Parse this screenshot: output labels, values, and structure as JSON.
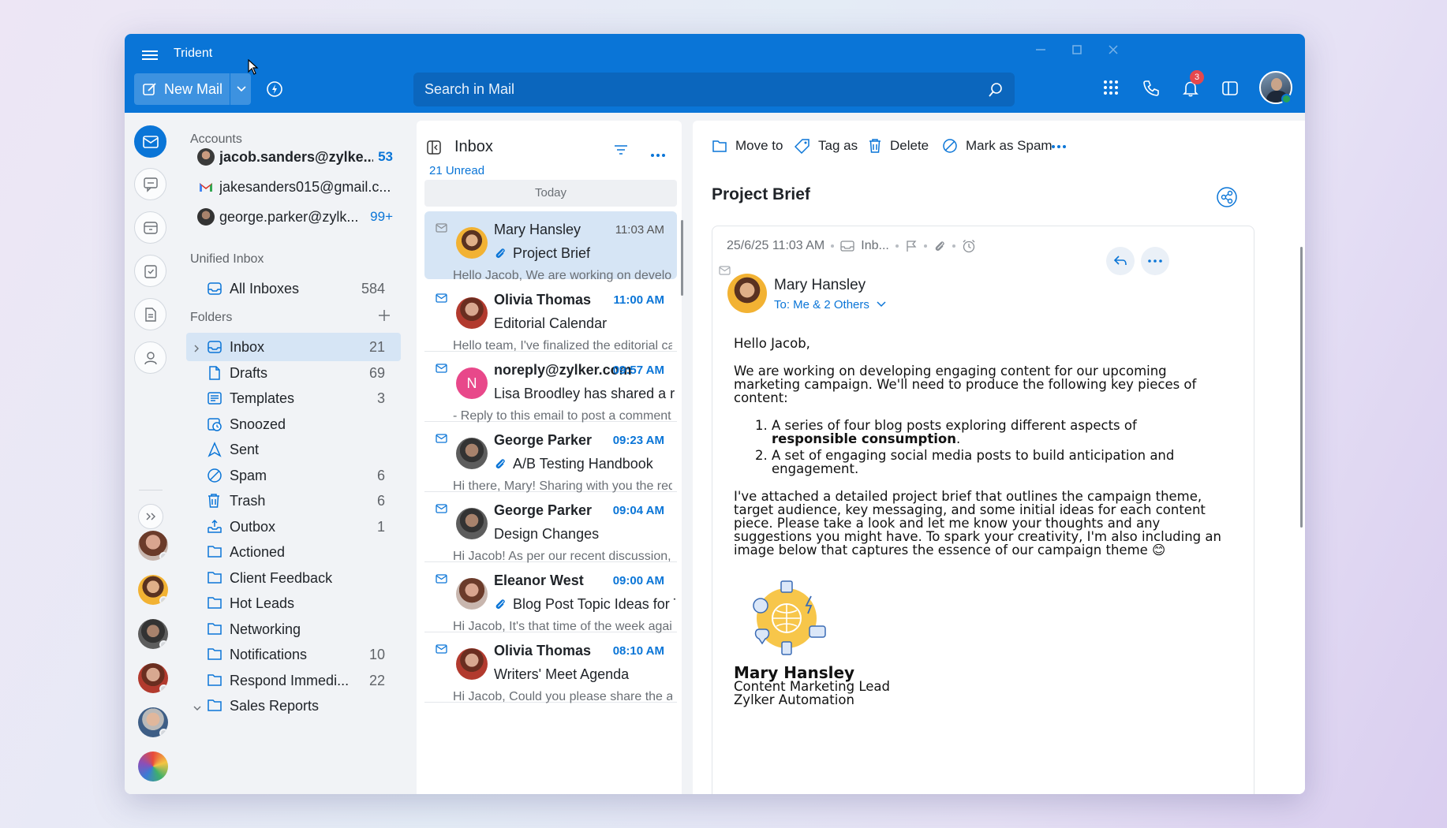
{
  "app": {
    "title": "Trident"
  },
  "toolbar": {
    "new_mail_label": "New Mail",
    "search_placeholder": "Search in Mail",
    "notification_count": "3"
  },
  "accounts": {
    "header": "Accounts",
    "items": [
      {
        "email": "jacob.sanders@zylke...",
        "count": "53"
      },
      {
        "email": "jakesanders015@gmail.c...",
        "count": ""
      },
      {
        "email": "george.parker@zylk...",
        "count": "99+"
      }
    ]
  },
  "unified": {
    "header": "Unified Inbox",
    "all_inboxes": {
      "label": "All Inboxes",
      "count": "584"
    }
  },
  "folders": {
    "header": "Folders",
    "items": [
      {
        "label": "Inbox",
        "count": "21"
      },
      {
        "label": "Drafts",
        "count": "69"
      },
      {
        "label": "Templates",
        "count": "3"
      },
      {
        "label": "Snoozed",
        "count": ""
      },
      {
        "label": "Sent",
        "count": ""
      },
      {
        "label": "Spam",
        "count": "6"
      },
      {
        "label": "Trash",
        "count": "6"
      },
      {
        "label": "Outbox",
        "count": "1"
      },
      {
        "label": "Actioned",
        "count": ""
      },
      {
        "label": "Client Feedback",
        "count": ""
      },
      {
        "label": "Hot Leads",
        "count": ""
      },
      {
        "label": "Networking",
        "count": ""
      },
      {
        "label": "Notifications",
        "count": "10"
      },
      {
        "label": "Respond Immedi...",
        "count": "22"
      },
      {
        "label": "Sales Reports",
        "count": ""
      }
    ]
  },
  "list": {
    "title": "Inbox",
    "unread": "21 Unread",
    "group": "Today",
    "mails": [
      {
        "from": "Mary Hansley",
        "time": "11:03 AM",
        "subject": "Project Brief",
        "preview": "Hello Jacob, We are working on developin...",
        "initial": ""
      },
      {
        "from": "Olivia Thomas",
        "time": "11:00 AM",
        "subject": "Editorial Calendar",
        "preview": "Hello team, I've finalized the editorial cale...",
        "initial": ""
      },
      {
        "from": "noreply@zylker.com",
        "time": "09:57 AM",
        "subject": "Lisa Broodley has shared a reco...",
        "preview": "- Reply to this email to post a comment in...",
        "initial": "N"
      },
      {
        "from": "George Parker",
        "time": "09:23 AM",
        "subject": "A/B Testing Handbook",
        "preview": "Hi there, Mary! Sharing with you the requ...",
        "initial": ""
      },
      {
        "from": "George Parker",
        "time": "09:04 AM",
        "subject": "Design Changes",
        "preview": "Hi Jacob! As per our recent discussion, I a...",
        "initial": ""
      },
      {
        "from": "Eleanor West",
        "time": "09:00 AM",
        "subject": "Blog Post Topic Ideas for Thi...",
        "preview": "Hi Jacob, It's that time of the week again...",
        "initial": ""
      },
      {
        "from": "Olivia Thomas",
        "time": "08:10 AM",
        "subject": "Writers' Meet Agenda",
        "preview": "Hi Jacob, Could you please share the agen...",
        "initial": ""
      }
    ]
  },
  "reader": {
    "actions": {
      "move": "Move to",
      "tag": "Tag as",
      "delete": "Delete",
      "spam": "Mark as Spam"
    },
    "subject": "Project Brief",
    "date": "25/6/25 11:03 AM",
    "folder": "Inb...",
    "sender": "Mary Hansley",
    "to": "To: Me & 2 Others",
    "greeting": "Hello Jacob,",
    "para1": "We are working on developing engaging content for our upcoming marketing campaign. We'll need to produce the following key pieces of content:",
    "li1_pre": "A series of four blog posts exploring different aspects of ",
    "li1_bold": "responsible consumption",
    "li1_post": ".",
    "li2": "A set of engaging social media posts to build anticipation and engagement.",
    "para2": "I've attached a detailed project brief that outlines the campaign theme, target audience, key messaging, and some initial ideas for each content piece. Please take a look and let me know your thoughts and any suggestions you might have. To spark your creativity, I'm also including an image below that captures the essence of our campaign theme 😊",
    "sig_name": "Mary Hansley",
    "sig_title": "Content Marketing Lead",
    "sig_company": "Zylker Automation"
  },
  "colors": {
    "accent": "#0a75d7",
    "selected": "#d6e5f5",
    "badge": "#e5484d"
  }
}
